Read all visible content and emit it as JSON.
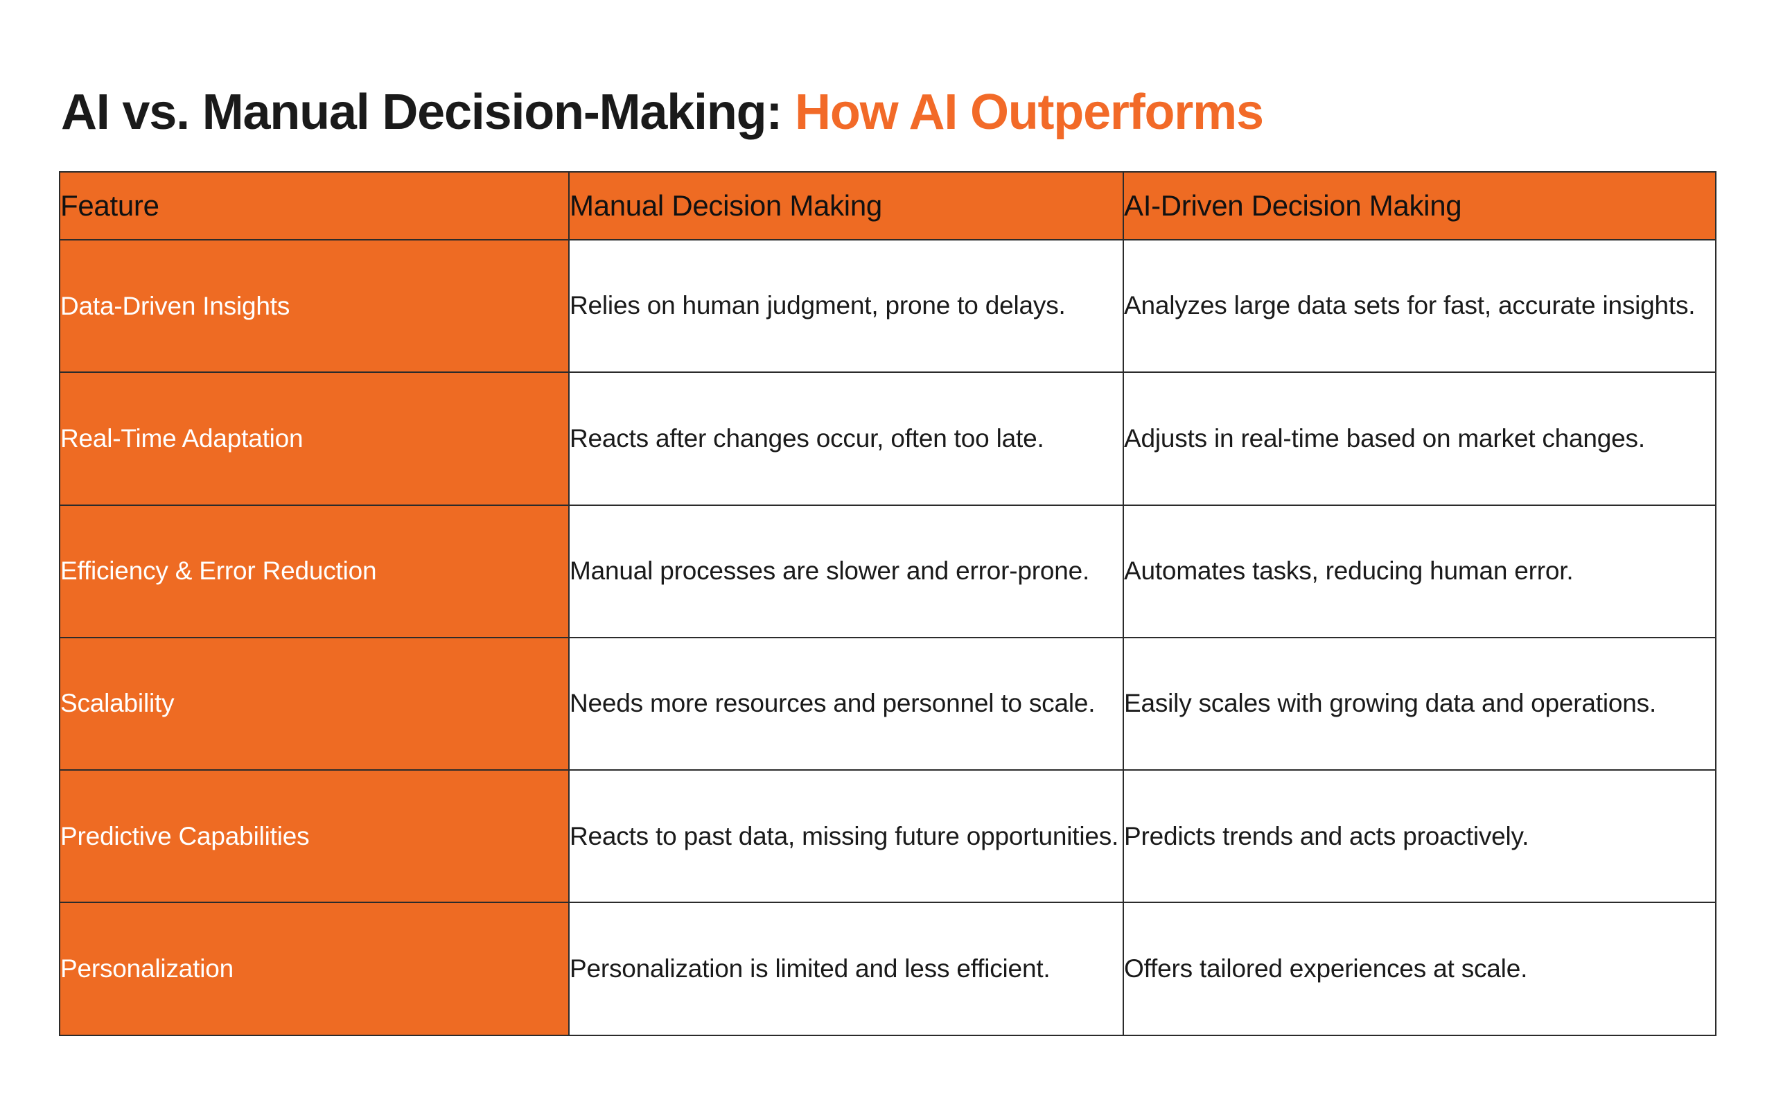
{
  "title": {
    "primary": "AI vs. Manual Decision-Making:",
    "accent": "How AI Outperforms"
  },
  "colors": {
    "accent_orange": "#ee6b23",
    "title_accent": "#f26a28",
    "text_dark": "#1a1a1a",
    "border": "#2b2b2b",
    "cell_white": "#ffffff"
  },
  "table": {
    "headers": {
      "feature": "Feature",
      "manual": "Manual Decision Making",
      "ai": "AI-Driven Decision Making"
    },
    "rows": [
      {
        "feature": "Data-Driven Insights",
        "manual": "Relies on human judgment, prone to delays.",
        "ai": "Analyzes large data sets for fast, accurate insights."
      },
      {
        "feature": "Real-Time Adaptation",
        "manual": "Reacts after changes occur, often too late.",
        "ai": "Adjusts in real-time based on market changes."
      },
      {
        "feature": "Efficiency & Error Reduction",
        "manual": "Manual processes are slower and error-prone.",
        "ai": "Automates tasks, reducing human error."
      },
      {
        "feature": "Scalability",
        "manual": "Needs more resources and personnel to scale.",
        "ai": "Easily scales with growing data and operations."
      },
      {
        "feature": "Predictive Capabilities",
        "manual": "Reacts to past data, missing future opportunities.",
        "ai": "Predicts trends and acts proactively."
      },
      {
        "feature": "Personalization",
        "manual": "Personalization is limited and less efficient.",
        "ai": "Offers tailored experiences at scale."
      }
    ]
  }
}
